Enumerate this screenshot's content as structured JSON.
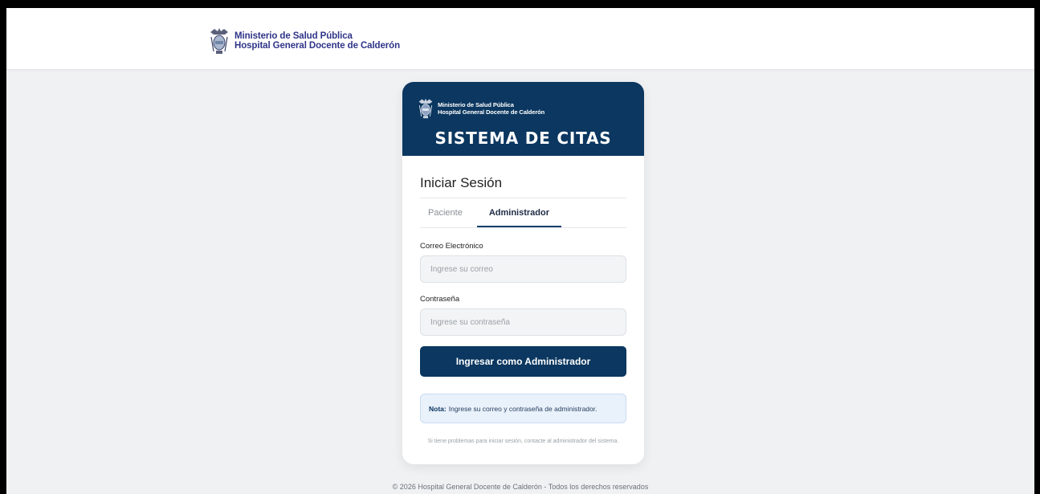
{
  "header": {
    "brand_line1": "Ministerio de Salud Pública",
    "brand_line2": "Hospital General Docente de Calderón",
    "crest_icon": "ecuador-coat-of-arms-icon"
  },
  "card": {
    "brand_line1": "Ministerio de Salud Pública",
    "brand_line2": "Hospital General Docente de Calderón",
    "system_title": "SISTEMA DE CITAS",
    "login_title": "Iniciar Sesión",
    "tabs": [
      {
        "label": "Paciente",
        "active": false
      },
      {
        "label": "Administrador",
        "active": true
      }
    ],
    "email_label": "Correo Electrónico",
    "email_placeholder": "Ingrese su correo",
    "email_value": "",
    "password_label": "Contraseña",
    "password_placeholder": "Ingrese su contraseña",
    "password_value": "",
    "submit_label": "Ingresar como Administrador",
    "note_prefix": "Nota:",
    "note_text": "Ingrese su correo y contraseña de administrador.",
    "help_text": "Si tiene problemas para iniciar sesión, contacte al administrador del sistema."
  },
  "footer": {
    "text": "© 2026 Hospital General Docente de Calderón - Todos los derechos reservados"
  },
  "colors": {
    "primary": "#0b3760",
    "brand_text": "#2f3488",
    "background": "#f0f1f3",
    "note_bg": "#e9f1fb"
  }
}
